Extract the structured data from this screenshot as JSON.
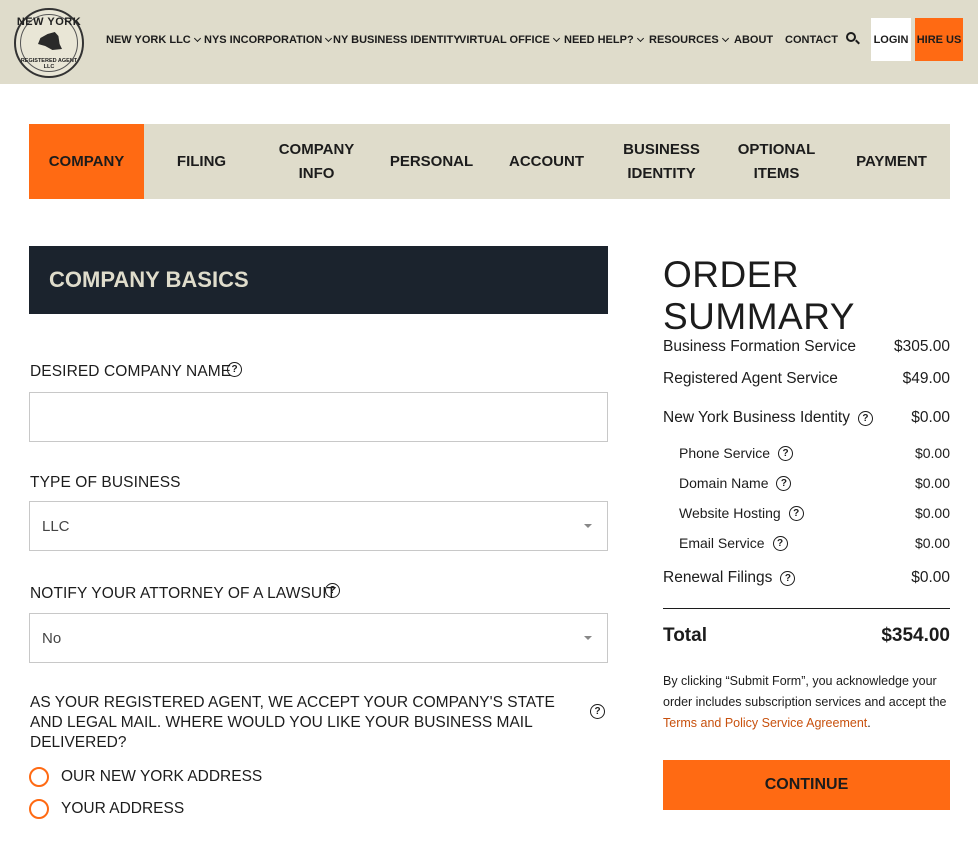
{
  "header": {
    "logo_top": "NEW YORK",
    "logo_bottom": "REGISTERED AGENT LLC",
    "nav": [
      {
        "label": "NEW YORK LLC",
        "dropdown": true
      },
      {
        "label": "NYS INCORPORATION",
        "dropdown": true
      },
      {
        "label": "NY BUSINESS IDENTITY",
        "dropdown": false
      },
      {
        "label": "VIRTUAL OFFICE",
        "dropdown": true
      },
      {
        "label": "NEED HELP?",
        "dropdown": true
      },
      {
        "label": "RESOURCES",
        "dropdown": true
      },
      {
        "label": "ABOUT",
        "dropdown": false
      },
      {
        "label": "CONTACT",
        "dropdown": false
      }
    ],
    "login_label": "LOGIN",
    "hire_label": "HIRE US"
  },
  "steps": [
    {
      "label": "COMPANY",
      "active": true
    },
    {
      "label": "FILING",
      "active": false
    },
    {
      "label": "COMPANY INFO",
      "active": false
    },
    {
      "label": "PERSONAL",
      "active": false
    },
    {
      "label": "ACCOUNT",
      "active": false
    },
    {
      "label": "BUSINESS IDENTITY",
      "active": false
    },
    {
      "label": "OPTIONAL ITEMS",
      "active": false
    },
    {
      "label": "PAYMENT",
      "active": false
    }
  ],
  "form": {
    "section_title": "COMPANY BASICS",
    "company_name_label": "DESIRED COMPANY NAME",
    "company_name_value": "",
    "business_type_label": "TYPE OF BUSINESS",
    "business_type_value": "LLC",
    "notify_label": "NOTIFY YOUR ATTORNEY OF A LAWSUIT",
    "notify_value": "No",
    "mail_question": "AS YOUR REGISTERED AGENT, WE ACCEPT YOUR COMPANY'S STATE AND LEGAL MAIL. WHERE WOULD YOU LIKE YOUR BUSINESS MAIL DELIVERED?",
    "mail_options": [
      "OUR NEW YORK ADDRESS",
      "YOUR ADDRESS"
    ]
  },
  "summary": {
    "title": "ORDER SUMMARY",
    "items": [
      {
        "name": "Business Formation Service",
        "price": "$305.00"
      },
      {
        "name": "Registered Agent Service",
        "price": "$49.00"
      },
      {
        "name": "New York Business Identity",
        "price": "$0.00"
      },
      {
        "name": "Phone Service",
        "price": "$0.00"
      },
      {
        "name": "Domain Name",
        "price": "$0.00"
      },
      {
        "name": "Website Hosting",
        "price": "$0.00"
      },
      {
        "name": "Email Service",
        "price": "$0.00"
      },
      {
        "name": "Renewal Filings",
        "price": "$0.00"
      }
    ],
    "total_label": "Total",
    "total_value": "$354.00",
    "disclaimer_before": "By clicking “Submit Form”, you acknowledge your order includes subscription services and accept the ",
    "disclaimer_link": "Terms and Policy Service Agreement",
    "disclaimer_after": ".",
    "continue_label": "CONTINUE"
  },
  "icons": {
    "help": "question-circle-icon",
    "search": "search-icon",
    "chevron": "chevron-down-icon"
  },
  "colors": {
    "accent": "#ff6a13",
    "header_bg": "#dfdccb",
    "section_head_bg": "#1b232d",
    "link": "#c8510e"
  }
}
